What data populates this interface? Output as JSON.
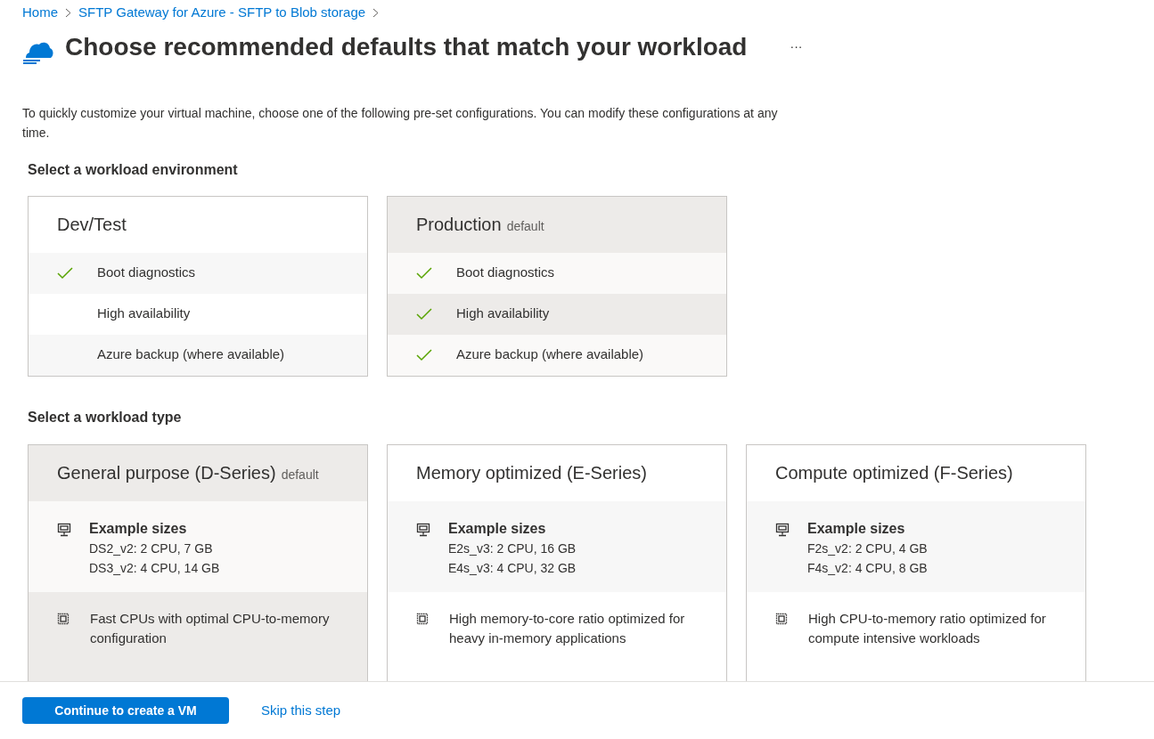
{
  "breadcrumb": [
    "Home",
    "SFTP Gateway for Azure - SFTP to Blob storage"
  ],
  "title": "Choose recommended defaults that match your workload",
  "more": "···",
  "intro": "To quickly customize your virtual machine, choose one of the following pre-set configurations. You can modify these configurations at any time.",
  "environment": {
    "heading": "Select a workload environment",
    "cards": [
      {
        "name": "Dev/Test",
        "selected": false,
        "features": [
          {
            "label": "Boot diagnostics",
            "checked": true
          },
          {
            "label": "High availability",
            "checked": false
          },
          {
            "label": "Azure backup (where available)",
            "checked": false
          }
        ]
      },
      {
        "name": "Production",
        "tag": "default",
        "selected": true,
        "features": [
          {
            "label": "Boot diagnostics",
            "checked": true
          },
          {
            "label": "High availability",
            "checked": true
          },
          {
            "label": "Azure backup (where available)",
            "checked": true
          }
        ]
      }
    ]
  },
  "workload_type": {
    "heading": "Select a workload type",
    "cards": [
      {
        "name": "General purpose (D-Series)",
        "tag": "default",
        "selected": true,
        "sizes_title": "Example sizes",
        "sizes": [
          "DS2_v2: 2 CPU, 7 GB",
          "DS3_v2: 4 CPU, 14 GB"
        ],
        "description": "Fast CPUs with optimal CPU-to-memory configuration"
      },
      {
        "name": "Memory optimized (E-Series)",
        "selected": false,
        "sizes_title": "Example sizes",
        "sizes": [
          "E2s_v3: 2 CPU, 16 GB",
          "E4s_v3: 4 CPU, 32 GB"
        ],
        "description": "High memory-to-core ratio optimized for heavy in-memory applications"
      },
      {
        "name": "Compute optimized (F-Series)",
        "selected": false,
        "sizes_title": "Example sizes",
        "sizes": [
          "F2s_v2: 2 CPU, 4 GB",
          "F4s_v2: 4 CPU, 8 GB"
        ],
        "description": "High CPU-to-memory ratio optimized for compute intensive workloads"
      }
    ]
  },
  "footer": {
    "primary": "Continue to create a VM",
    "secondary": "Skip this step"
  }
}
